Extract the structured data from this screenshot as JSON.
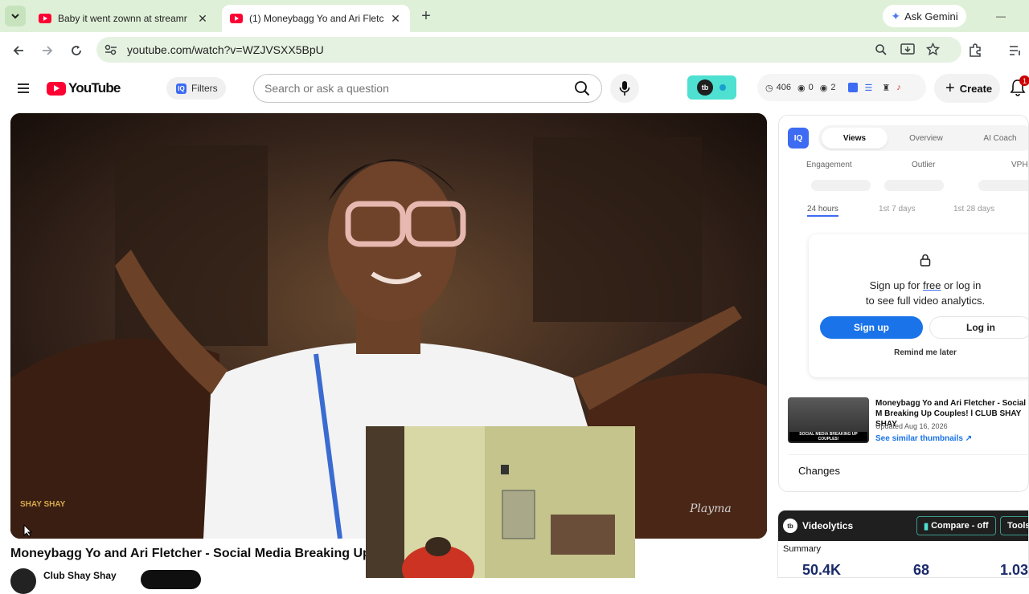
{
  "browser": {
    "tabs": [
      {
        "title": "Baby it went zownn at streamr",
        "active": false
      },
      {
        "title": "(1) Moneybagg Yo and Ari Fletc",
        "active": true
      }
    ],
    "new_tab": "+",
    "gemini": "Ask Gemini",
    "minimize": "—",
    "url": "youtube.com/watch?v=WZJVSXX5BpU"
  },
  "yt": {
    "logo": "YouTube",
    "filters": "Filters",
    "search_placeholder": "Search or ask a question",
    "stats": {
      "views": "406",
      "eyes": "0",
      "viewers": "2"
    },
    "create": "Create",
    "notif_count": "1"
  },
  "video": {
    "title": "Moneybagg Yo and Ari Fletcher - Social Media Breaking Up Co",
    "channel": "Club Shay Shay",
    "watermark_left": "SHAY SHAY",
    "watermark_right": "Playma"
  },
  "vidiq": {
    "badge": "IQ",
    "tabs": [
      "Views",
      "Overview",
      "AI Coach"
    ],
    "metrics": [
      "Engagement",
      "Outlier",
      "VPH"
    ],
    "time_filters": [
      "24 hours",
      "1st 7 days",
      "1st 28 days"
    ],
    "lock_text_1": "Sign up for",
    "lock_link": "free",
    "lock_text_2": "or log in",
    "lock_text_3": "to see full video analytics.",
    "signup": "Sign up",
    "login": "Log in",
    "remind": "Remind me later",
    "thumb_title": "Moneybagg Yo and Ari Fletcher - Social M Breaking Up Couples! l CLUB SHAY SHAY",
    "thumb_updated": "Updated Aug 16, 2026",
    "thumb_link": "See similar thumbnails ↗",
    "thumb_caption": "SOCIAL MEDIA BREAKING UP COUPLES!"
  },
  "changes": "Changes",
  "videolytics": {
    "name": "Videolytics",
    "compare": "Compare - off",
    "tools": "Tools",
    "summary": "Summary",
    "values": [
      "50.4K",
      "68",
      "1.03"
    ]
  }
}
